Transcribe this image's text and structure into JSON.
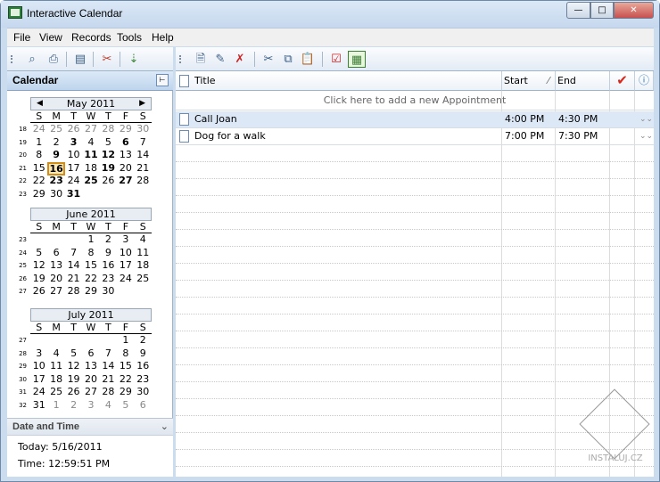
{
  "window": {
    "title": "Interactive Calendar",
    "close_symbol": "✕"
  },
  "menu": [
    "File",
    "View",
    "Records",
    "Tools",
    "Help"
  ],
  "sidebar": {
    "title": "Calendar",
    "pin_symbol": "⊢"
  },
  "dow": [
    "S",
    "M",
    "T",
    "W",
    "T",
    "F",
    "S"
  ],
  "months": [
    {
      "name": "May 2011",
      "weeks": [
        {
          "n": "18",
          "days": [
            {
              "d": "24",
              "s": "o"
            },
            {
              "d": "25",
              "s": "o"
            },
            {
              "d": "26",
              "s": "o"
            },
            {
              "d": "27",
              "s": "o"
            },
            {
              "d": "28",
              "s": "o"
            },
            {
              "d": "29",
              "s": "o"
            },
            {
              "d": "30",
              "s": "o"
            }
          ]
        },
        {
          "n": "19",
          "days": [
            {
              "d": "1"
            },
            {
              "d": "2"
            },
            {
              "d": "3",
              "s": "b"
            },
            {
              "d": "4"
            },
            {
              "d": "5"
            },
            {
              "d": "6",
              "s": "b"
            },
            {
              "d": "7"
            }
          ]
        },
        {
          "n": "20",
          "days": [
            {
              "d": "8"
            },
            {
              "d": "9",
              "s": "b"
            },
            {
              "d": "10"
            },
            {
              "d": "11",
              "s": "b"
            },
            {
              "d": "12",
              "s": "b"
            },
            {
              "d": "13"
            },
            {
              "d": "14"
            }
          ]
        },
        {
          "n": "21",
          "days": [
            {
              "d": "15"
            },
            {
              "d": "16",
              "s": "today"
            },
            {
              "d": "17"
            },
            {
              "d": "18"
            },
            {
              "d": "19",
              "s": "b"
            },
            {
              "d": "20"
            },
            {
              "d": "21"
            }
          ]
        },
        {
          "n": "22",
          "days": [
            {
              "d": "22"
            },
            {
              "d": "23",
              "s": "b"
            },
            {
              "d": "24"
            },
            {
              "d": "25",
              "s": "b"
            },
            {
              "d": "26"
            },
            {
              "d": "27",
              "s": "b"
            },
            {
              "d": "28"
            }
          ]
        },
        {
          "n": "23",
          "days": [
            {
              "d": "29"
            },
            {
              "d": "30"
            },
            {
              "d": "31",
              "s": "b"
            },
            {
              "d": ""
            },
            {
              "d": ""
            },
            {
              "d": ""
            },
            {
              "d": ""
            }
          ]
        }
      ]
    },
    {
      "name": "June 2011",
      "weeks": [
        {
          "n": "23",
          "days": [
            {
              "d": ""
            },
            {
              "d": ""
            },
            {
              "d": ""
            },
            {
              "d": "1"
            },
            {
              "d": "2"
            },
            {
              "d": "3"
            },
            {
              "d": "4"
            }
          ]
        },
        {
          "n": "24",
          "days": [
            {
              "d": "5"
            },
            {
              "d": "6"
            },
            {
              "d": "7"
            },
            {
              "d": "8"
            },
            {
              "d": "9"
            },
            {
              "d": "10"
            },
            {
              "d": "11"
            }
          ]
        },
        {
          "n": "25",
          "days": [
            {
              "d": "12"
            },
            {
              "d": "13"
            },
            {
              "d": "14"
            },
            {
              "d": "15"
            },
            {
              "d": "16"
            },
            {
              "d": "17"
            },
            {
              "d": "18"
            }
          ]
        },
        {
          "n": "26",
          "days": [
            {
              "d": "19"
            },
            {
              "d": "20"
            },
            {
              "d": "21"
            },
            {
              "d": "22"
            },
            {
              "d": "23"
            },
            {
              "d": "24"
            },
            {
              "d": "25"
            }
          ]
        },
        {
          "n": "27",
          "days": [
            {
              "d": "26"
            },
            {
              "d": "27"
            },
            {
              "d": "28"
            },
            {
              "d": "29"
            },
            {
              "d": "30"
            },
            {
              "d": ""
            },
            {
              "d": ""
            }
          ]
        }
      ]
    },
    {
      "name": "July 2011",
      "weeks": [
        {
          "n": "27",
          "days": [
            {
              "d": ""
            },
            {
              "d": ""
            },
            {
              "d": ""
            },
            {
              "d": ""
            },
            {
              "d": ""
            },
            {
              "d": "1"
            },
            {
              "d": "2"
            }
          ]
        },
        {
          "n": "28",
          "days": [
            {
              "d": "3"
            },
            {
              "d": "4"
            },
            {
              "d": "5"
            },
            {
              "d": "6"
            },
            {
              "d": "7"
            },
            {
              "d": "8"
            },
            {
              "d": "9"
            }
          ]
        },
        {
          "n": "29",
          "days": [
            {
              "d": "10"
            },
            {
              "d": "11"
            },
            {
              "d": "12"
            },
            {
              "d": "13"
            },
            {
              "d": "14"
            },
            {
              "d": "15"
            },
            {
              "d": "16"
            }
          ]
        },
        {
          "n": "30",
          "days": [
            {
              "d": "17"
            },
            {
              "d": "18"
            },
            {
              "d": "19"
            },
            {
              "d": "20"
            },
            {
              "d": "21"
            },
            {
              "d": "22"
            },
            {
              "d": "23"
            }
          ]
        },
        {
          "n": "31",
          "days": [
            {
              "d": "24"
            },
            {
              "d": "25"
            },
            {
              "d": "26"
            },
            {
              "d": "27"
            },
            {
              "d": "28"
            },
            {
              "d": "29"
            },
            {
              "d": "30"
            }
          ]
        },
        {
          "n": "32",
          "days": [
            {
              "d": "31"
            },
            {
              "d": "1",
              "s": "o"
            },
            {
              "d": "2",
              "s": "o"
            },
            {
              "d": "3",
              "s": "o"
            },
            {
              "d": "4",
              "s": "o"
            },
            {
              "d": "5",
              "s": "o"
            },
            {
              "d": "6",
              "s": "o"
            }
          ]
        }
      ]
    }
  ],
  "datetime": {
    "title": "Date and Time",
    "today": "Today: 5/16/2011",
    "time": "Time: 12:59:51 PM"
  },
  "columns": {
    "title": "Title",
    "start": "Start",
    "end": "End"
  },
  "add_hint": "Click here to add a new Appointment",
  "appointments": [
    {
      "title": "Call Joan",
      "start": "4:00 PM",
      "end": "4:30 PM"
    },
    {
      "title": "Dog for a walk",
      "start": "7:00 PM",
      "end": "7:30 PM"
    }
  ],
  "watermark": "INSTALUJ.CZ",
  "colors": {
    "accent": "#cbdcef",
    "check": "#d9261c",
    "today": "#fde8b8"
  }
}
